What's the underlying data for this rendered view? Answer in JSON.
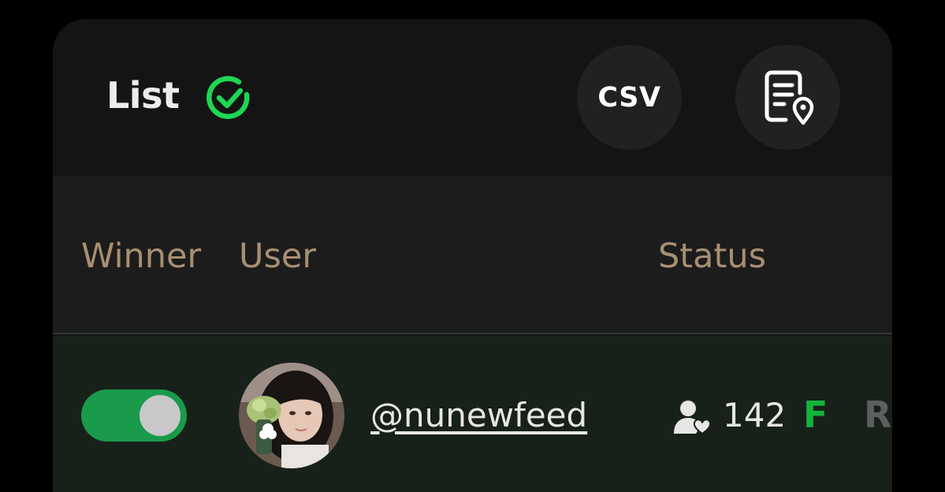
{
  "header": {
    "title": "List",
    "check_icon": "check-circle-icon",
    "csv_label": "CSV",
    "report_icon": "document-location-icon",
    "accent": "#1fd655"
  },
  "table": {
    "columns": [
      "Winner",
      "User",
      "Status"
    ],
    "rows": [
      {
        "winner": true,
        "avatar": "user-avatar",
        "username": "@nunewfeed",
        "status_icon": "follower-icon",
        "count": "142",
        "badge_f": "F",
        "badge_r": "R"
      }
    ]
  },
  "colors": {
    "background": "#000000",
    "panel": "#141414",
    "header_row": "#1c1c1c",
    "column_header_text": "#a88f72",
    "row_bg": "#182119",
    "toggle_on": "#1a9a4b",
    "badge_f": "#13b43c",
    "badge_r": "#5f5f5f"
  }
}
